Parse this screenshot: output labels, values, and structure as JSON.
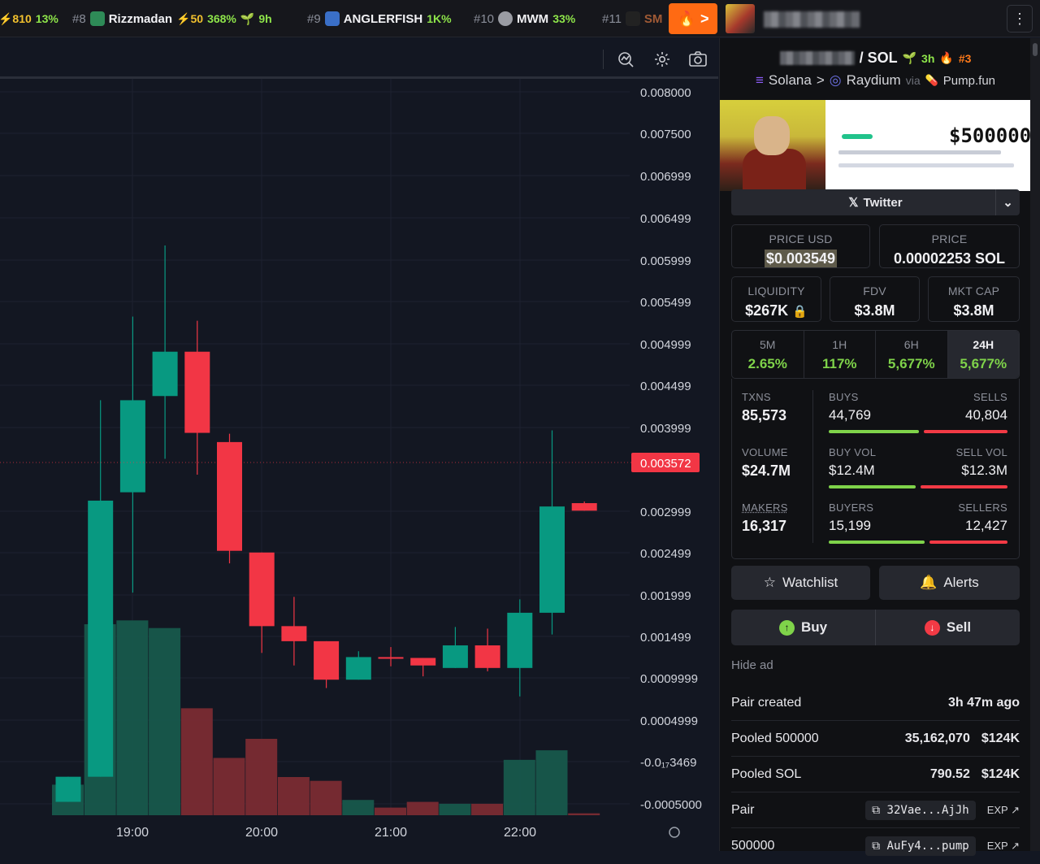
{
  "ticker": [
    {
      "rank": "",
      "name": "",
      "boost": "⚡810",
      "change": "13%"
    },
    {
      "rank": "#8",
      "name": "Rizzmadan",
      "boost": "⚡50",
      "change": "368%",
      "age": "9h"
    },
    {
      "rank": "#9",
      "name": "ANGLERFISH",
      "change": "1K%"
    },
    {
      "rank": "#10",
      "name": "MWM",
      "change": "33%"
    },
    {
      "rank": "#11",
      "name": "SM"
    }
  ],
  "trending_button": {
    "label": ">"
  },
  "menu_label": "⋮",
  "chart": {
    "price_axis": [
      "0.008000",
      "0.007500",
      "0.006999",
      "0.006499",
      "0.005999",
      "0.005499",
      "0.004999",
      "0.004499",
      "0.003999",
      "0.003572",
      "0.002999",
      "0.002499",
      "0.001999",
      "0.001499",
      "0.0009999",
      "0.0004999",
      "-0.0₁₇3469",
      "-0.0005000"
    ],
    "time_axis": [
      "19:00",
      "20:00",
      "21:00",
      "22:00"
    ],
    "current_price_label": "0.003572"
  },
  "chart_data": {
    "type": "candlestick",
    "current_price": 0.003572,
    "ylim": [
      -0.0005,
      0.008
    ],
    "x_ticks": [
      "19:00",
      "20:00",
      "21:00",
      "22:00"
    ],
    "candles": [
      {
        "o": 0.0,
        "c": 0.0003,
        "h": 0.0003,
        "l": 0.0,
        "vol": 0.08
      },
      {
        "o": 0.0003,
        "c": 0.0036,
        "h": 0.0048,
        "l": 0.0003,
        "vol": 0.5
      },
      {
        "o": 0.0037,
        "c": 0.0048,
        "h": 0.0058,
        "l": 0.0025,
        "vol": 0.51
      },
      {
        "o": 0.00485,
        "c": 0.00538,
        "h": 0.00665,
        "l": 0.0041,
        "vol": 0.49
      },
      {
        "o": 0.00538,
        "c": 0.00441,
        "h": 0.00575,
        "l": 0.00391,
        "vol": 0.28
      },
      {
        "o": 0.0043,
        "c": 0.003,
        "h": 0.0044,
        "l": 0.00285,
        "vol": 0.15
      },
      {
        "o": 0.00298,
        "c": 0.0021,
        "h": 0.00298,
        "l": 0.00178,
        "vol": 0.2
      },
      {
        "o": 0.0021,
        "c": 0.00192,
        "h": 0.00245,
        "l": 0.00163,
        "vol": 0.1
      },
      {
        "o": 0.00192,
        "c": 0.00146,
        "h": 0.00192,
        "l": 0.00136,
        "vol": 0.09
      },
      {
        "o": 0.00146,
        "c": 0.00173,
        "h": 0.0018,
        "l": 0.00146,
        "vol": 0.04
      },
      {
        "o": 0.00173,
        "c": 0.00171,
        "h": 0.00185,
        "l": 0.00162,
        "vol": 0.02
      },
      {
        "o": 0.00172,
        "c": 0.00163,
        "h": 0.00172,
        "l": 0.0015,
        "vol": 0.035
      },
      {
        "o": 0.0016,
        "c": 0.00187,
        "h": 0.00209,
        "l": 0.0016,
        "vol": 0.03
      },
      {
        "o": 0.00187,
        "c": 0.0016,
        "h": 0.00207,
        "l": 0.00156,
        "vol": 0.03
      },
      {
        "o": 0.0016,
        "c": 0.00226,
        "h": 0.00242,
        "l": 0.00126,
        "vol": 0.145
      },
      {
        "o": 0.00226,
        "c": 0.00353,
        "h": 0.00444,
        "l": 0.002,
        "vol": 0.17
      },
      {
        "o": 0.00357,
        "c": 0.00348,
        "h": 0.00359,
        "l": 0.00348,
        "vol": 0.005
      }
    ]
  },
  "pair": {
    "base_blur": "",
    "slash_quote": "/ SOL",
    "age": "3h",
    "rank": "#3"
  },
  "chain": {
    "chain": "Solana",
    "sep": ">",
    "dex": "Raydium",
    "via": "via",
    "launchpad": "Pump.fun"
  },
  "banner": {
    "amount": "$500000"
  },
  "social": {
    "label": "Twitter"
  },
  "price_usd": {
    "label": "PRICE USD",
    "value": "$0.003549"
  },
  "price_native": {
    "label": "PRICE",
    "value": "0.00002253 SOL"
  },
  "liquidity": {
    "label": "LIQUIDITY",
    "value": "$267K"
  },
  "fdv": {
    "label": "FDV",
    "value": "$3.8M"
  },
  "mktcap": {
    "label": "MKT CAP",
    "value": "$3.8M"
  },
  "timeframes": [
    {
      "key": "5M",
      "pct": "2.65%"
    },
    {
      "key": "1H",
      "pct": "117%"
    },
    {
      "key": "6H",
      "pct": "5,677%"
    },
    {
      "key": "24H",
      "pct": "5,677%"
    }
  ],
  "stats": {
    "txns": {
      "label": "TXNS",
      "value": "85,573"
    },
    "buys": {
      "label": "BUYS",
      "value": "44,769",
      "ratio": 0.52
    },
    "sells": {
      "label": "SELLS",
      "value": "40,804"
    },
    "volume": {
      "label": "VOLUME",
      "value": "$24.7M"
    },
    "buy_vol": {
      "label": "BUY VOL",
      "value": "$12.4M",
      "ratio": 0.5
    },
    "sell_vol": {
      "label": "SELL VOL",
      "value": "$12.3M"
    },
    "makers": {
      "label": "MAKERS",
      "value": "16,317"
    },
    "buyers": {
      "label": "BUYERS",
      "value": "15,199",
      "ratio": 0.55
    },
    "sellers": {
      "label": "SELLERS",
      "value": "12,427"
    }
  },
  "actions": {
    "watchlist": "Watchlist",
    "alerts": "Alerts",
    "buy": "Buy",
    "sell": "Sell"
  },
  "hide_ad": "Hide ad",
  "info": {
    "pair_created": {
      "label": "Pair created",
      "value": "3h 47m ago"
    },
    "pooled_token": {
      "label": "Pooled 500000",
      "amount": "35,162,070",
      "usd": "$124K"
    },
    "pooled_sol": {
      "label": "Pooled SOL",
      "amount": "790.52",
      "usd": "$124K"
    },
    "pair": {
      "label": "Pair",
      "address": "32Vae...AjJh",
      "exp": "EXP"
    },
    "token": {
      "label": "500000",
      "address": "AuFy4...pump",
      "exp": "EXP"
    }
  },
  "colors": {
    "up": "#089981",
    "down": "#f23645",
    "panel_bg": "#101114",
    "chart_bg": "#131722",
    "accent": "#ff6a13",
    "positive": "#7fd34a"
  }
}
